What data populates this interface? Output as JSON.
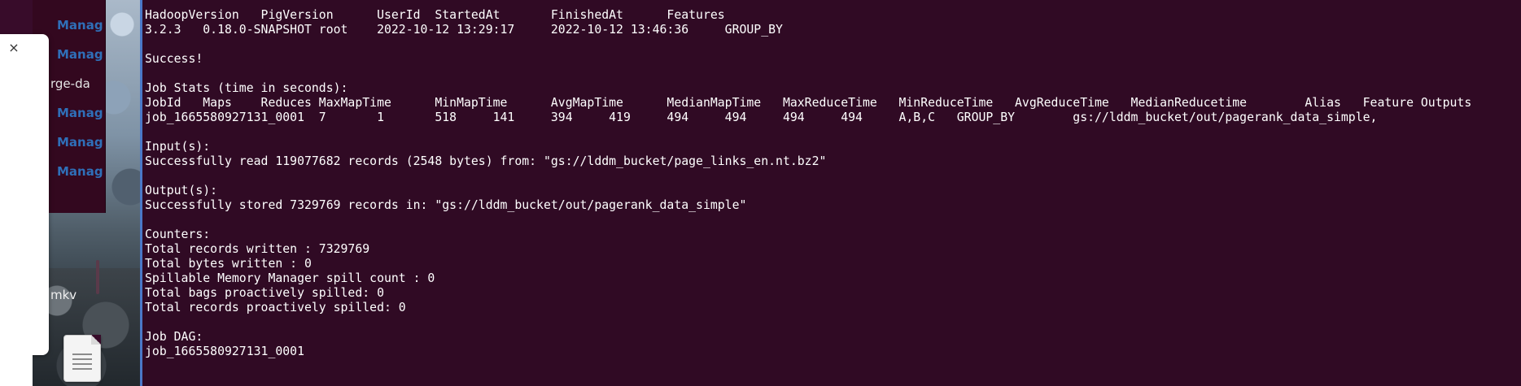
{
  "file_manager": {
    "items": [
      "Manag",
      "Manag",
      "rge-da",
      "Manag",
      "Manag",
      "Manag"
    ],
    "file_label": "mkv"
  },
  "dialog": {
    "close_glyph": "×"
  },
  "terminal": {
    "lines": [
      "HadoopVersion   PigVersion      UserId  StartedAt       FinishedAt      Features",
      "3.2.3   0.18.0-SNAPSHOT root    2022-10-12 13:29:17     2022-10-12 13:46:36     GROUP_BY",
      "",
      "Success!",
      "",
      "Job Stats (time in seconds):",
      "JobId   Maps    Reduces MaxMapTime      MinMapTime      AvgMapTime      MedianMapTime   MaxReduceTime   MinReduceTime   AvgReduceTime   MedianReducetime        Alias   Feature Outputs",
      "job_1665580927131_0001  7       1       518     141     394     419     494     494     494     494     A,B,C   GROUP_BY        gs://lddm_bucket/out/pagerank_data_simple,",
      "",
      "Input(s):",
      "Successfully read 119077682 records (2548 bytes) from: \"gs://lddm_bucket/page_links_en.nt.bz2\"",
      "",
      "Output(s):",
      "Successfully stored 7329769 records in: \"gs://lddm_bucket/out/pagerank_data_simple\"",
      "",
      "Counters:",
      "Total records written : 7329769",
      "Total bytes written : 0",
      "Spillable Memory Manager spill count : 0",
      "Total bags proactively spilled: 0",
      "Total records proactively spilled: 0",
      "",
      "Job DAG:",
      "job_1665580927131_0001"
    ]
  },
  "colors": {
    "terminal_bg": "#300a24",
    "terminal_text": "#ffffff",
    "focus_border": "#4a78c8",
    "link_blue": "#2f6fb8"
  }
}
